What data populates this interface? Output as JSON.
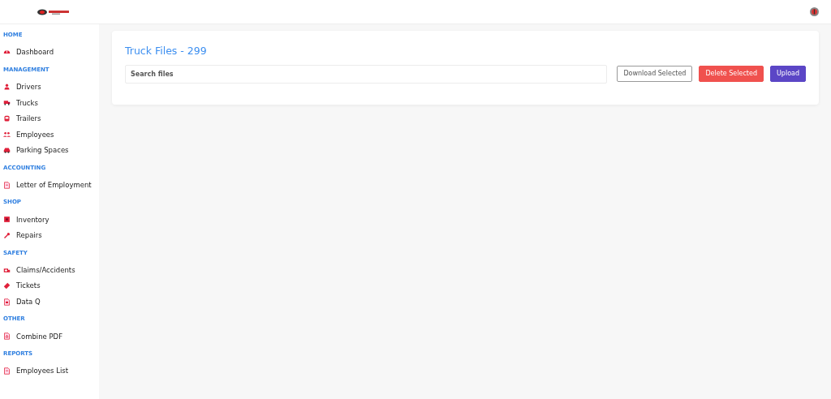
{
  "sidebar": {
    "sections": [
      {
        "heading": "HOME",
        "items": [
          {
            "label": "Dashboard"
          }
        ]
      },
      {
        "heading": "MANAGEMENT",
        "items": [
          {
            "label": "Drivers"
          },
          {
            "label": "Trucks"
          },
          {
            "label": "Trailers"
          },
          {
            "label": "Employees"
          },
          {
            "label": "Parking Spaces"
          }
        ]
      },
      {
        "heading": "ACCOUNTING",
        "items": [
          {
            "label": "Letter of Employment"
          }
        ]
      },
      {
        "heading": "SHOP",
        "items": [
          {
            "label": "Inventory"
          },
          {
            "label": "Repairs"
          }
        ]
      },
      {
        "heading": "SAFETY",
        "items": [
          {
            "label": "Claims/Accidents"
          },
          {
            "label": "Tickets"
          },
          {
            "label": "Data Q"
          }
        ]
      },
      {
        "heading": "OTHER",
        "items": [
          {
            "label": "Combine PDF"
          }
        ]
      },
      {
        "heading": "REPORTS",
        "items": [
          {
            "label": "Employees List"
          }
        ]
      }
    ]
  },
  "page": {
    "title": "Truck Files - 299",
    "search": {
      "placeholder": "Search files"
    },
    "buttons": [
      {
        "label": "Download Selected",
        "kind": "outline"
      },
      {
        "label": "Delete Selected",
        "kind": "danger"
      },
      {
        "label": "Upload",
        "kind": "primary"
      }
    ]
  }
}
